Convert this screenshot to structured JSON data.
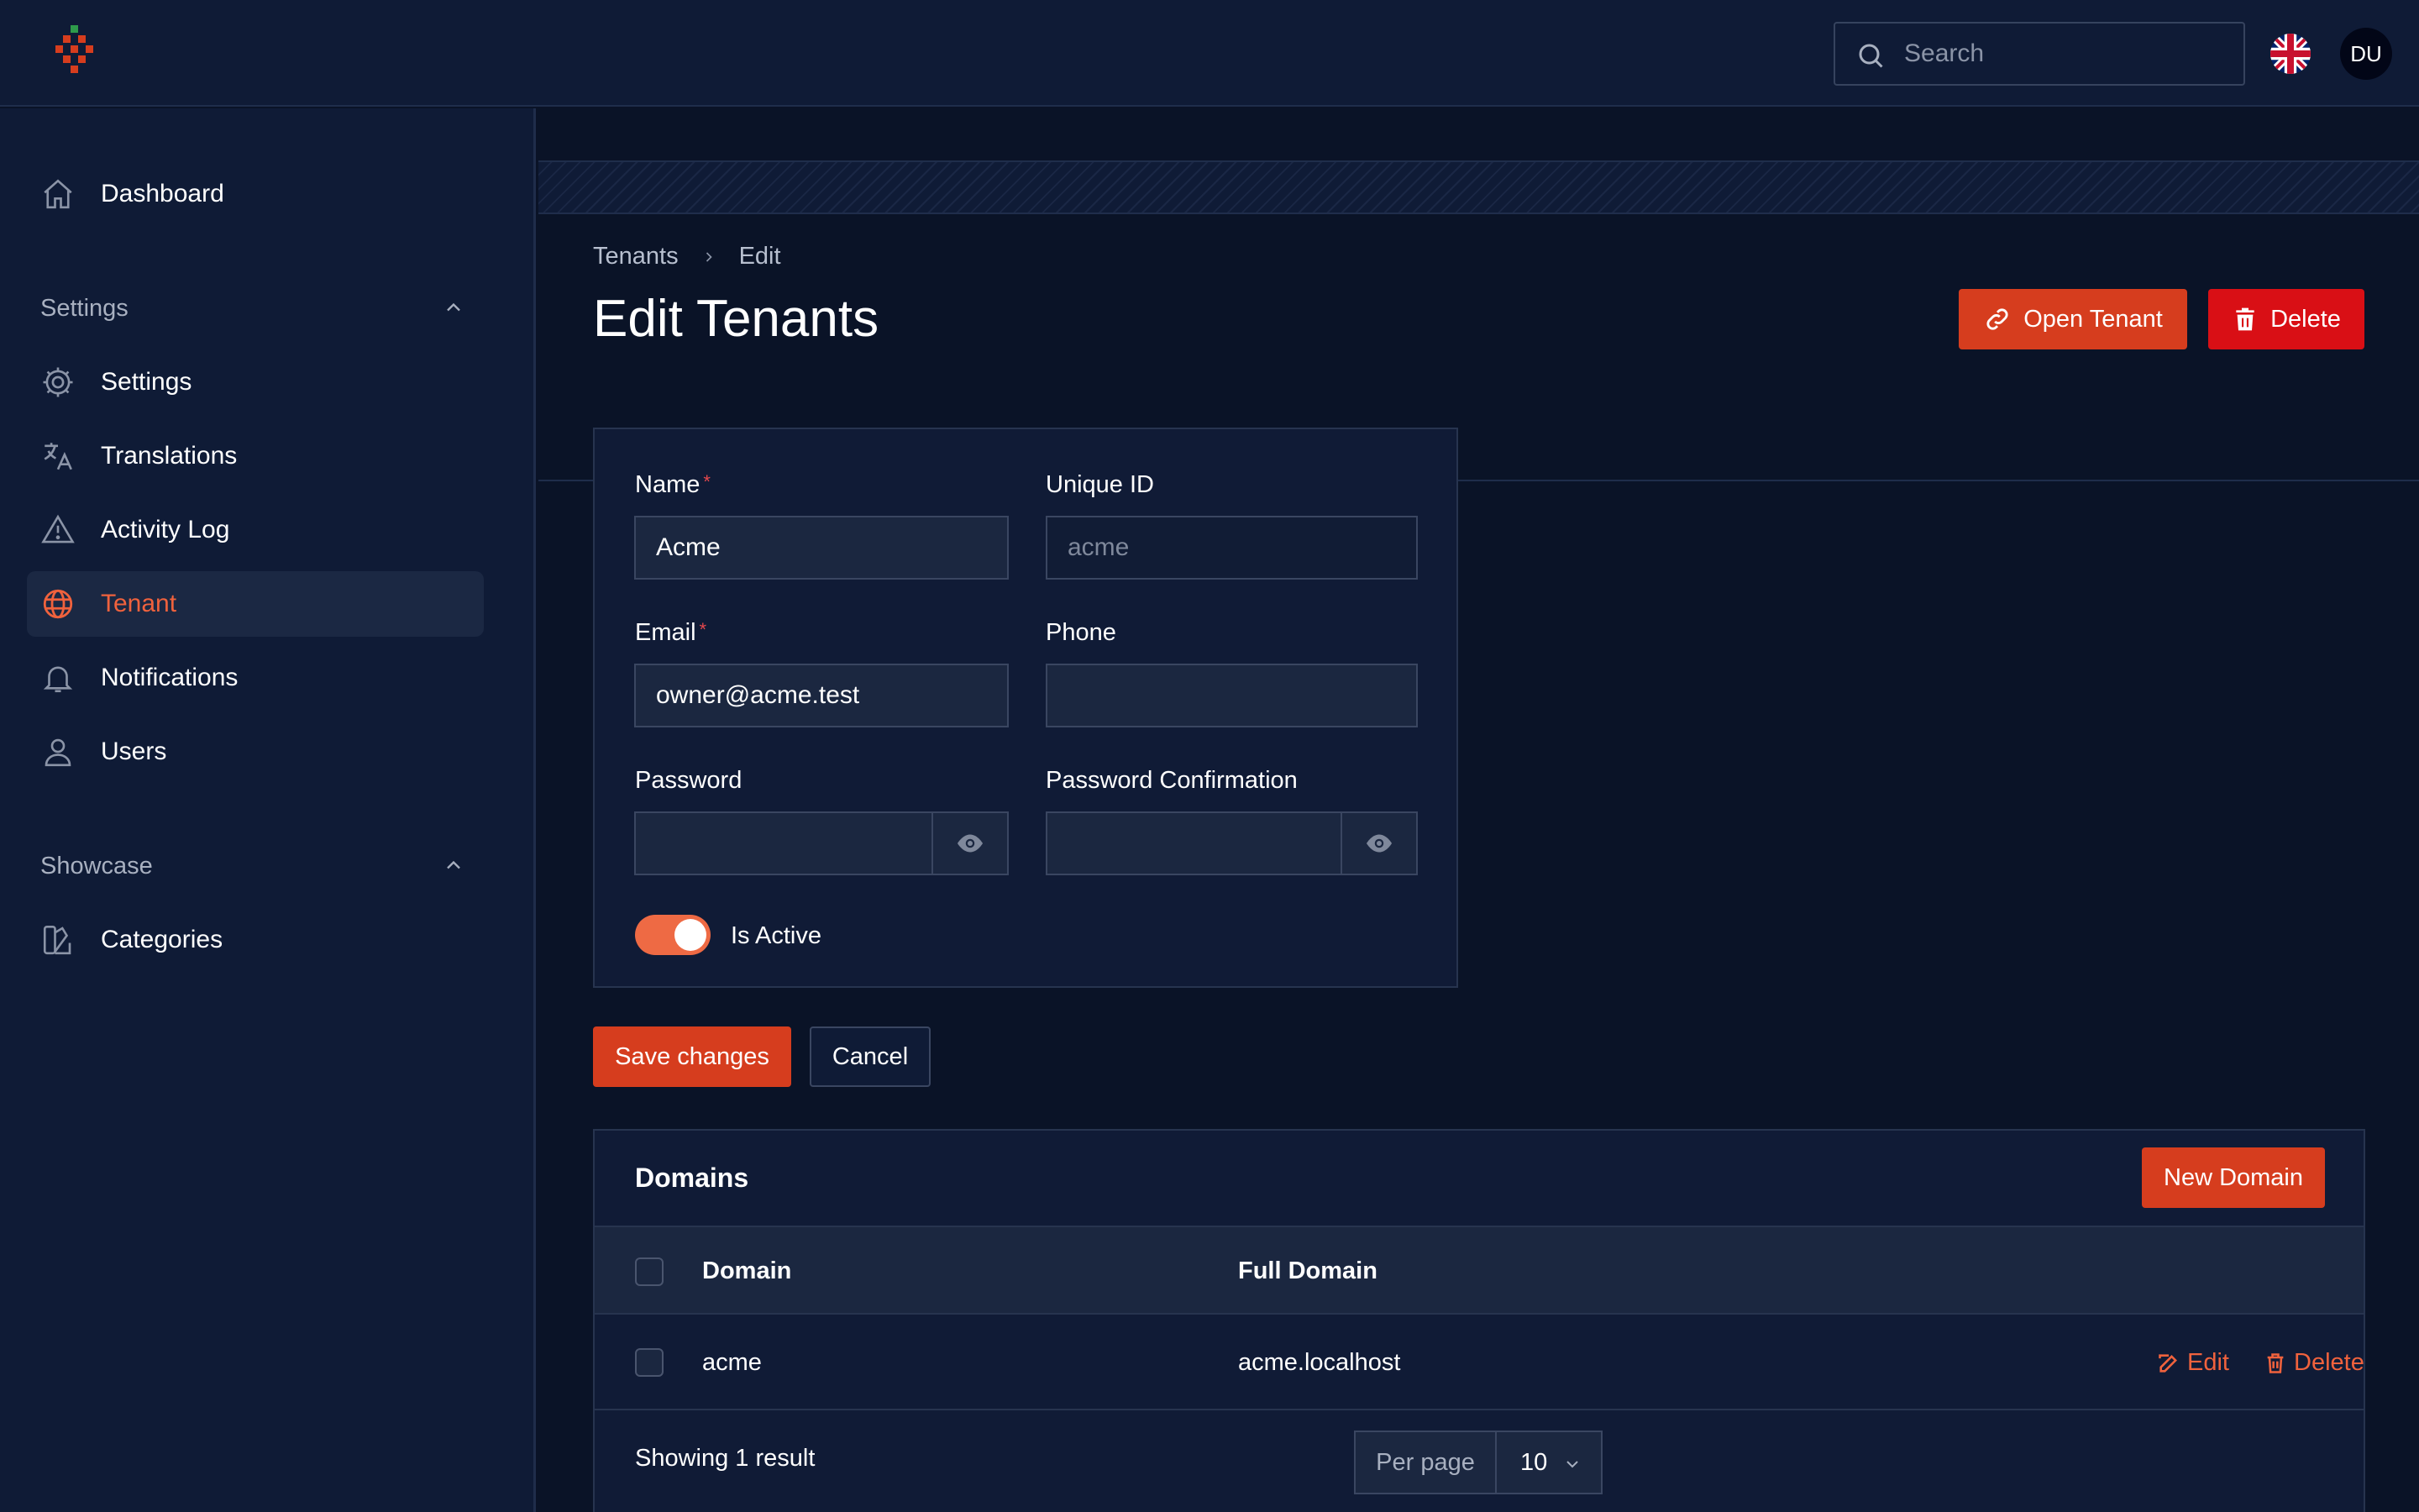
{
  "header": {
    "search_placeholder": "Search",
    "avatar_initials": "DU",
    "language_flag": "uk-flag-icon"
  },
  "sidebar": {
    "top_items": [
      {
        "label": "Dashboard",
        "icon": "home-icon"
      }
    ],
    "groups": [
      {
        "label": "Settings",
        "items": [
          {
            "label": "Settings",
            "icon": "gear-icon"
          },
          {
            "label": "Translations",
            "icon": "translate-icon"
          },
          {
            "label": "Activity Log",
            "icon": "warning-icon"
          },
          {
            "label": "Tenant",
            "icon": "globe-icon",
            "active": true
          },
          {
            "label": "Notifications",
            "icon": "bell-icon"
          },
          {
            "label": "Users",
            "icon": "user-icon"
          }
        ]
      },
      {
        "label": "Showcase",
        "items": [
          {
            "label": "Categories",
            "icon": "swatch-icon"
          }
        ]
      }
    ]
  },
  "page": {
    "breadcrumb": [
      "Tenants",
      "Edit"
    ],
    "title": "Edit Tenants",
    "actions": {
      "open_tenant": "Open Tenant",
      "delete": "Delete"
    }
  },
  "form": {
    "name": {
      "label": "Name",
      "value": "Acme",
      "required": true
    },
    "unique_id": {
      "label": "Unique ID",
      "value": "acme"
    },
    "email": {
      "label": "Email",
      "value": "owner@acme.test",
      "required": true
    },
    "phone": {
      "label": "Phone",
      "value": ""
    },
    "password": {
      "label": "Password",
      "value": ""
    },
    "password_confirmation": {
      "label": "Password Confirmation",
      "value": ""
    },
    "is_active": {
      "label": "Is Active",
      "value": true
    },
    "save_label": "Save changes",
    "cancel_label": "Cancel"
  },
  "domains": {
    "title": "Domains",
    "new_label": "New Domain",
    "columns": [
      "Domain",
      "Full Domain"
    ],
    "rows": [
      {
        "domain": "acme",
        "full_domain": "acme.localhost",
        "edit_label": "Edit",
        "delete_label": "Delete"
      }
    ],
    "showing": "Showing 1 result",
    "per_page_label": "Per page",
    "per_page_value": "10"
  },
  "colors": {
    "accent": "#d63d1e",
    "danger": "#d90f15",
    "active_text": "#f0623d",
    "background": "#0a1327",
    "panel": "#0f1b36"
  }
}
